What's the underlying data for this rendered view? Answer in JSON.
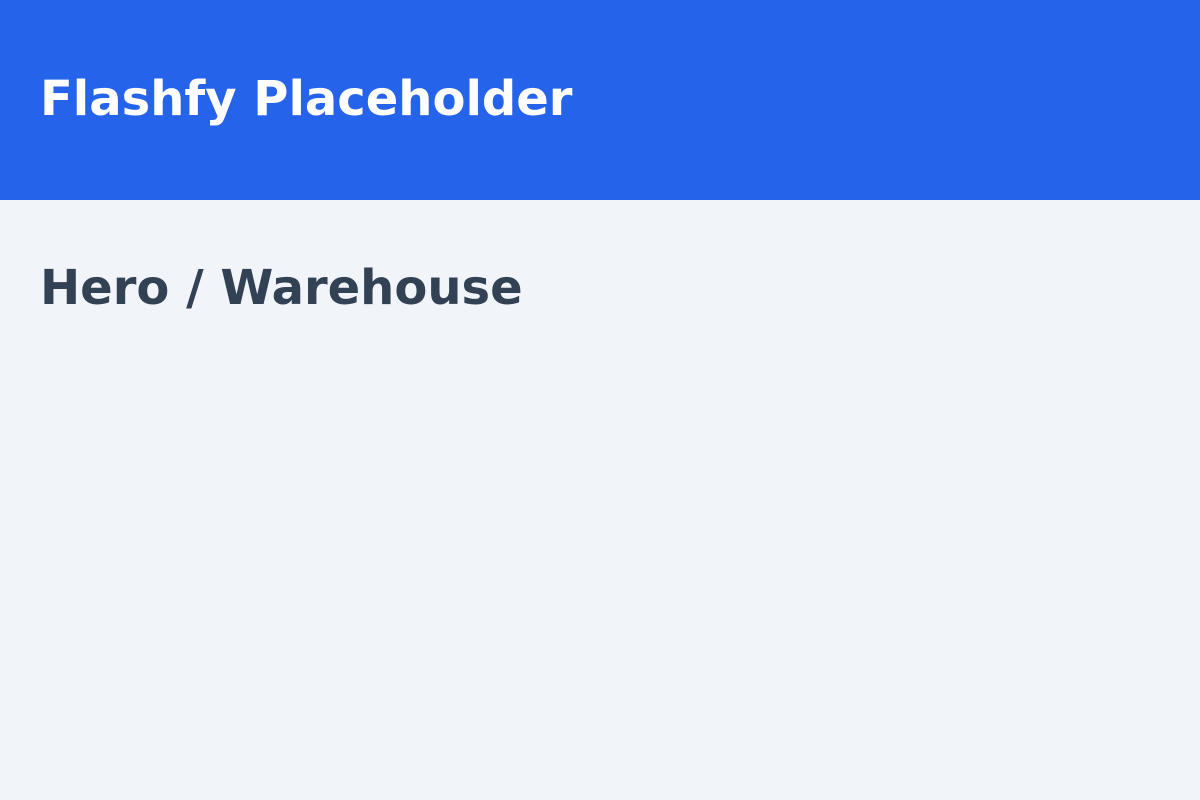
{
  "header": {
    "title": "Flashfy Placeholder",
    "background_color": "#2563eb",
    "text_color": "#ffffff"
  },
  "content": {
    "label": "Hero / Warehouse",
    "background_color": "#f1f5f9",
    "text_color": "#334155"
  }
}
